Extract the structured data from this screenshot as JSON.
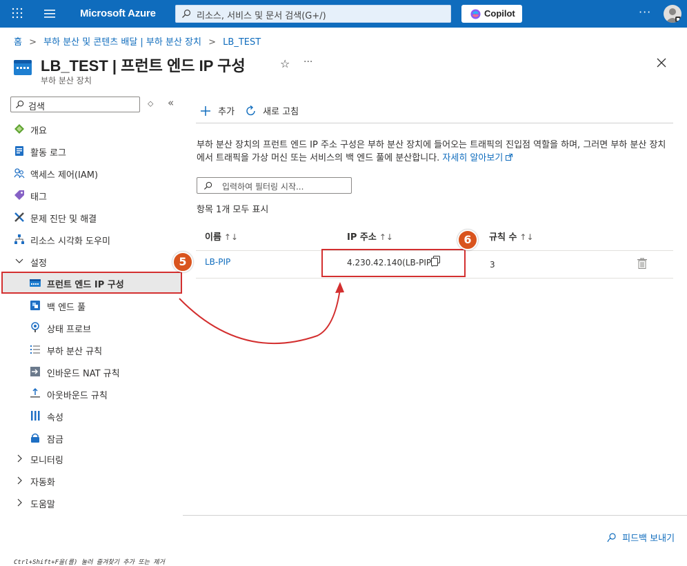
{
  "topbar": {
    "brand": "Microsoft Azure",
    "search_placeholder": "리소스, 서비스 및 문서 검색(G+/)",
    "copilot_label": "Copilot",
    "more_label": "···"
  },
  "breadcrumb": [
    "홈",
    "부하 분산 및 콘텐츠 배달 | 부하 분산 장치",
    "LB_TEST"
  ],
  "header": {
    "title": "LB_TEST | 프런트 엔드 IP 구성",
    "subtitle": "부하 분산 장치",
    "more_label": "···"
  },
  "sidebar": {
    "search_placeholder": "검색",
    "items": [
      {
        "label": "개요",
        "icon": "overview-icon"
      },
      {
        "label": "활동 로그",
        "icon": "activity-log-icon"
      },
      {
        "label": "액세스 제어(IAM)",
        "icon": "iam-icon"
      },
      {
        "label": "태그",
        "icon": "tag-icon"
      },
      {
        "label": "문제 진단 및 해결",
        "icon": "diagnose-icon"
      },
      {
        "label": "리소스 시각화 도우미",
        "icon": "visualizer-icon"
      }
    ],
    "settings_group": "설정",
    "settings_items": [
      {
        "label": "프런트 엔드 IP 구성",
        "icon": "frontend-ip-icon",
        "selected": true
      },
      {
        "label": "백 엔드 풀",
        "icon": "backend-pool-icon"
      },
      {
        "label": "상태 프로브",
        "icon": "health-probe-icon"
      },
      {
        "label": "부하 분산 규칙",
        "icon": "lb-rules-icon"
      },
      {
        "label": "인바운드 NAT 규칙",
        "icon": "inbound-nat-icon"
      },
      {
        "label": "아웃바운드 규칙",
        "icon": "outbound-rules-icon"
      },
      {
        "label": "속성",
        "icon": "properties-icon"
      },
      {
        "label": "잠금",
        "icon": "lock-icon"
      }
    ],
    "collapsed_groups": [
      "모니터링",
      "자동화",
      "도움말"
    ]
  },
  "toolbar": {
    "add_label": "추가",
    "refresh_label": "새로 고침"
  },
  "description": {
    "text": "부하 분산 장치의 프런트 엔드 IP 주소 구성은 부하 분산 장치에 들어오는 트래픽의 진입점 역할을 하며, 그러면 부하 분산 장치에서 트래픽을 가상 머신 또는 서비스의 백 엔드 풀에 분산합니다. ",
    "link": "자세히 알아보기"
  },
  "filter": {
    "placeholder": "입력하여 필터링 시작..."
  },
  "count_text": "항목 1개 모두 표시",
  "table": {
    "columns": [
      "이름",
      "IP 주소",
      "규칙 수"
    ],
    "rows": [
      {
        "name": "LB-PIP",
        "ip": "4.230.42.140(LB-PIP)",
        "rules": "3"
      }
    ]
  },
  "annotations": {
    "badge5": "5",
    "badge6": "6",
    "highlight_color": "#d32f2f",
    "badge_color": "#d9541e"
  },
  "footer": {
    "feedback_label": "피드백 보내기",
    "hint": "Ctrl+Shift+F을(를) 눌러 즐겨찾기 추가 또는 제거"
  },
  "colors": {
    "accent": "#0f6cbd",
    "topbar": "#0f6cbd"
  }
}
